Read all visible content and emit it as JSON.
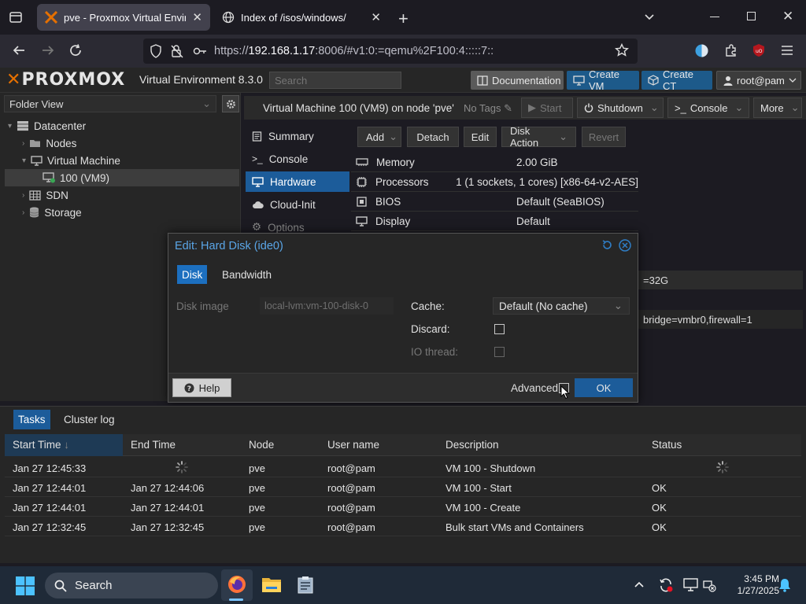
{
  "browser": {
    "tabs": [
      {
        "title": "pve - Proxmox Virtual Environment"
      },
      {
        "title": "Index of /isos/windows/"
      }
    ],
    "url_prefix": "https://",
    "url_host": "192.168.1.17",
    "url_rest": ":8006/#v1:0:=qemu%2F100:4:::::7::"
  },
  "header": {
    "logo_text": "PROXMOX",
    "product": "Virtual Environment 8.3.0",
    "search_placeholder": "Search",
    "documentation": "Documentation",
    "create_vm": "Create VM",
    "create_ct": "Create CT",
    "user": "root@pam"
  },
  "left": {
    "view": "Folder View",
    "tree": [
      {
        "label": "Datacenter"
      },
      {
        "label": "Nodes"
      },
      {
        "label": "Virtual Machine"
      },
      {
        "label": "100 (VM9)"
      },
      {
        "label": "SDN"
      },
      {
        "label": "Storage"
      }
    ]
  },
  "vm": {
    "title": "Virtual Machine 100 (VM9) on node 'pve'",
    "no_tags": "No Tags",
    "start": "Start",
    "shutdown": "Shutdown",
    "console": "Console",
    "more": "More"
  },
  "nav": [
    {
      "label": "Summary"
    },
    {
      "label": "Console"
    },
    {
      "label": "Hardware"
    },
    {
      "label": "Cloud-Init"
    },
    {
      "label": "Options"
    }
  ],
  "toolbar": {
    "add": "Add",
    "detach": "Detach",
    "edit": "Edit",
    "disk_action": "Disk Action",
    "revert": "Revert"
  },
  "hardware": [
    {
      "key": "Memory",
      "value": "2.00 GiB"
    },
    {
      "key": "Processors",
      "value": "1 (1 sockets, 1 cores) [x86-64-v2-AES]"
    },
    {
      "key": "BIOS",
      "value": "Default (SeaBIOS)"
    },
    {
      "key": "Display",
      "value": "Default"
    }
  ],
  "hw_overflow": {
    "disk": "=32G",
    "net": "bridge=vmbr0,firewall=1"
  },
  "dialog": {
    "title": "Edit: Hard Disk (ide0)",
    "tab_disk": "Disk",
    "tab_bandwidth": "Bandwidth",
    "disk_image_label": "Disk image",
    "disk_image_value": "local-lvm:vm-100-disk-0",
    "cache_label": "Cache:",
    "cache_value": "Default (No cache)",
    "discard_label": "Discard:",
    "io_thread_label": "IO thread:",
    "help": "Help",
    "advanced": "Advanced",
    "ok": "OK"
  },
  "tasks": {
    "tab_tasks": "Tasks",
    "tab_cluster": "Cluster log",
    "columns": [
      "Start Time",
      "End Time",
      "Node",
      "User name",
      "Description",
      "Status"
    ],
    "rows": [
      {
        "start": "Jan 27 12:45:33",
        "end": "",
        "node": "pve",
        "user": "root@pam",
        "desc": "VM 100 - Shutdown",
        "status": ""
      },
      {
        "start": "Jan 27 12:44:01",
        "end": "Jan 27 12:44:06",
        "node": "pve",
        "user": "root@pam",
        "desc": "VM 100 - Start",
        "status": "OK"
      },
      {
        "start": "Jan 27 12:44:01",
        "end": "Jan 27 12:44:01",
        "node": "pve",
        "user": "root@pam",
        "desc": "VM 100 - Create",
        "status": "OK"
      },
      {
        "start": "Jan 27 12:32:45",
        "end": "Jan 27 12:32:45",
        "node": "pve",
        "user": "root@pam",
        "desc": "Bulk start VMs and Containers",
        "status": "OK"
      }
    ]
  },
  "taskbar": {
    "search": "Search",
    "time": "3:45 PM",
    "date": "1/27/2025"
  },
  "colors": {
    "accent": "#1c5c9a",
    "brand_orange": "#e57000",
    "dialog_title": "#5aa6e8"
  }
}
